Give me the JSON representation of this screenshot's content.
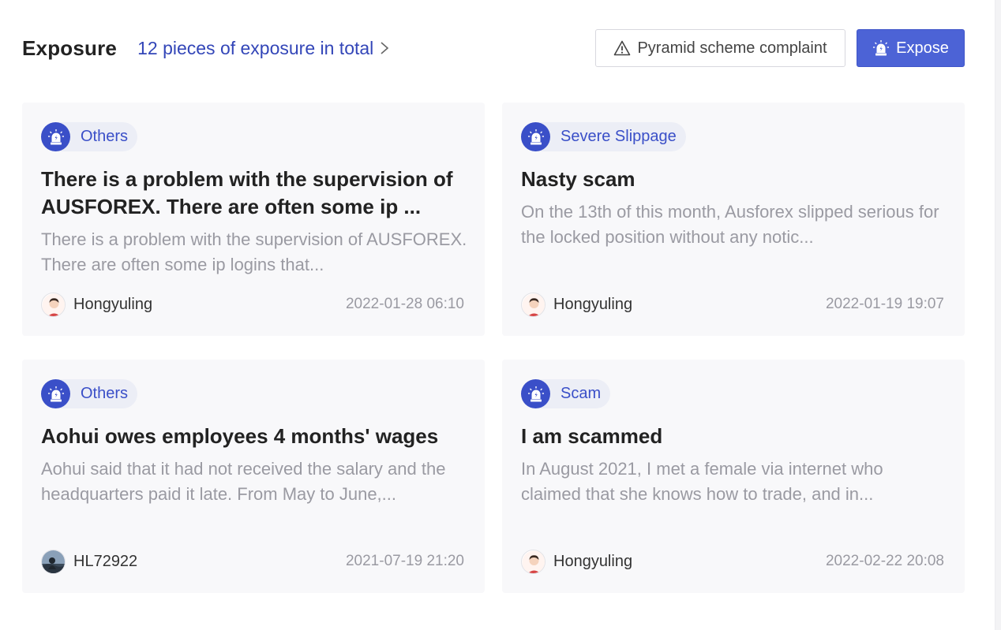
{
  "header": {
    "title": "Exposure",
    "total_link": "12 pieces of exposure in total",
    "complaint_button": "Pyramid scheme complaint",
    "expose_button": "Expose"
  },
  "colors": {
    "accent": "#3a4fc8",
    "primary_button": "#4c63d6",
    "card_bg": "#f8f8fa",
    "muted_text": "#9a9aa2"
  },
  "icons": {
    "total_link": "chevron-right-icon",
    "complaint": "warning-triangle-icon",
    "expose": "alarm-siren-icon",
    "tag": "alarm-siren-icon"
  },
  "cards": [
    {
      "tag": "Others",
      "title": "There is a problem with the supervision of AUSFOREX. There are often some ip ...",
      "description": "There is a problem with the supervision of AUSFOREX. There are often some ip logins that...",
      "author": "Hongyuling",
      "avatar": "cartoon-person-avatar",
      "date": "2022-01-28 06:10"
    },
    {
      "tag": "Severe Slippage",
      "title": "Nasty scam",
      "description": "On the 13th of this month, Ausforex slipped serious for the locked position without any notic...",
      "author": "Hongyuling",
      "avatar": "cartoon-person-avatar",
      "date": "2022-01-19 19:07"
    },
    {
      "tag": "Others",
      "title": "Aohui owes employees 4 months' wages",
      "description": "Aohui said that it had not received the salary and the headquarters paid it late. From May to June,...",
      "author": "HL72922",
      "avatar": "photo-avatar",
      "date": "2021-07-19 21:20"
    },
    {
      "tag": "Scam",
      "title": "I am scammed",
      "description": "In August 2021, I met a female via internet who claimed that she knows how to trade, and in...",
      "author": "Hongyuling",
      "avatar": "cartoon-person-avatar",
      "date": "2022-02-22 20:08"
    }
  ]
}
